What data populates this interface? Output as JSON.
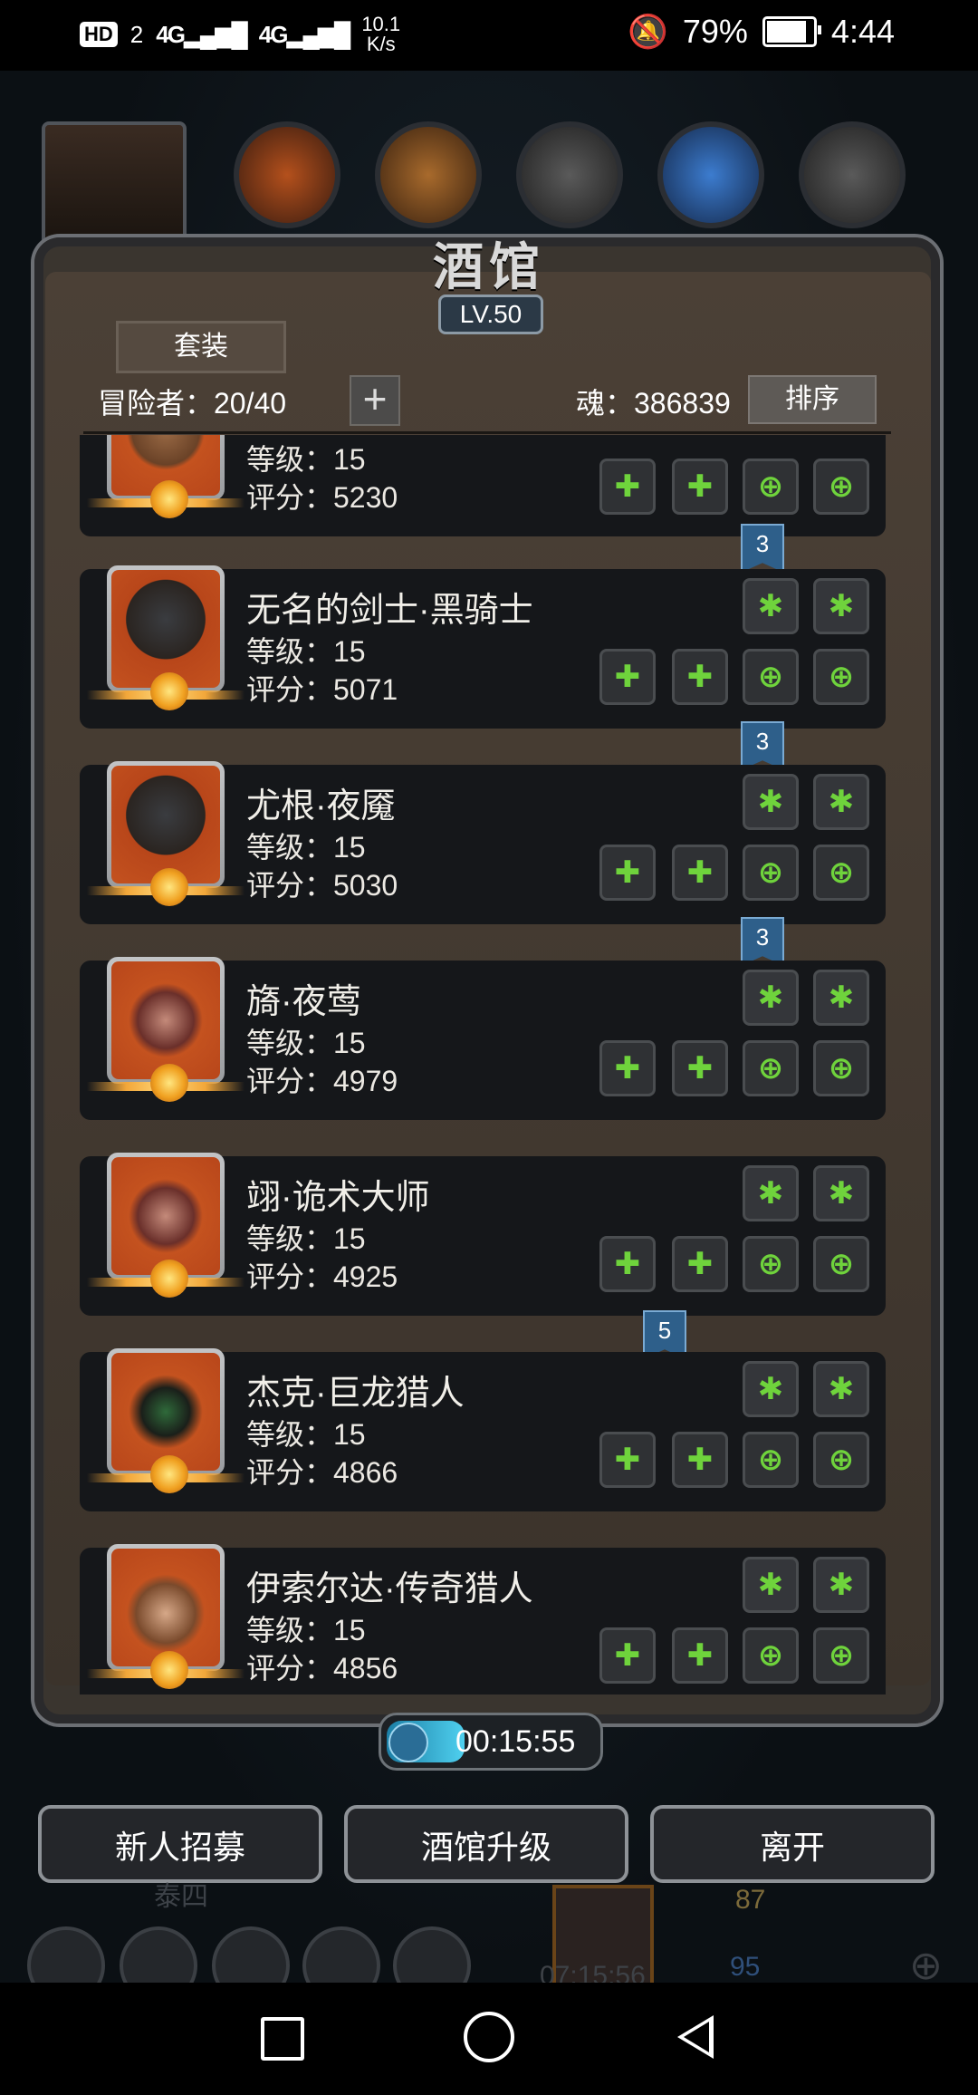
{
  "status_bar": {
    "hd": "HD",
    "sim": "2",
    "net1": "4G",
    "net2": "4G",
    "speed_value": "10.1",
    "speed_unit": "K/s",
    "battery": "79%",
    "battery_level": 0.79,
    "time": "4:44"
  },
  "header": {
    "title": "酒馆",
    "level": "LV.50",
    "suit_button": "套装",
    "adventurers": "冒险者：20/40",
    "add_button": "+",
    "soul": "魂：386839",
    "sort_button": "排序"
  },
  "heroes": [
    {
      "name": "",
      "level": "等级：15",
      "score": "评分：5230",
      "ribbon": "3"
    },
    {
      "name": "无名的剑士·黑骑士",
      "level": "等级：15",
      "score": "评分：5071",
      "ribbon": "3"
    },
    {
      "name": "尤根·夜魇",
      "level": "等级：15",
      "score": "评分：5030",
      "ribbon": "3"
    },
    {
      "name": "旖·夜莺",
      "level": "等级：15",
      "score": "评分：4979",
      "ribbon": ""
    },
    {
      "name": "翊·诡术大师",
      "level": "等级：15",
      "score": "评分：4925",
      "ribbon": "5"
    },
    {
      "name": "杰克·巨龙猎人",
      "level": "等级：15",
      "score": "评分：4866",
      "ribbon": ""
    },
    {
      "name": "伊索尔达·传奇猎人",
      "level": "等级：15",
      "score": "评分：4856",
      "ribbon": ""
    }
  ],
  "timer": "00:15:55",
  "buttons": {
    "recruit": "新人招募",
    "upgrade": "酒馆升级",
    "leave": "离开"
  },
  "hud": {
    "behind_label": "泰四",
    "gold": "87",
    "gems": "95",
    "chest_timer": "07:15:56"
  }
}
